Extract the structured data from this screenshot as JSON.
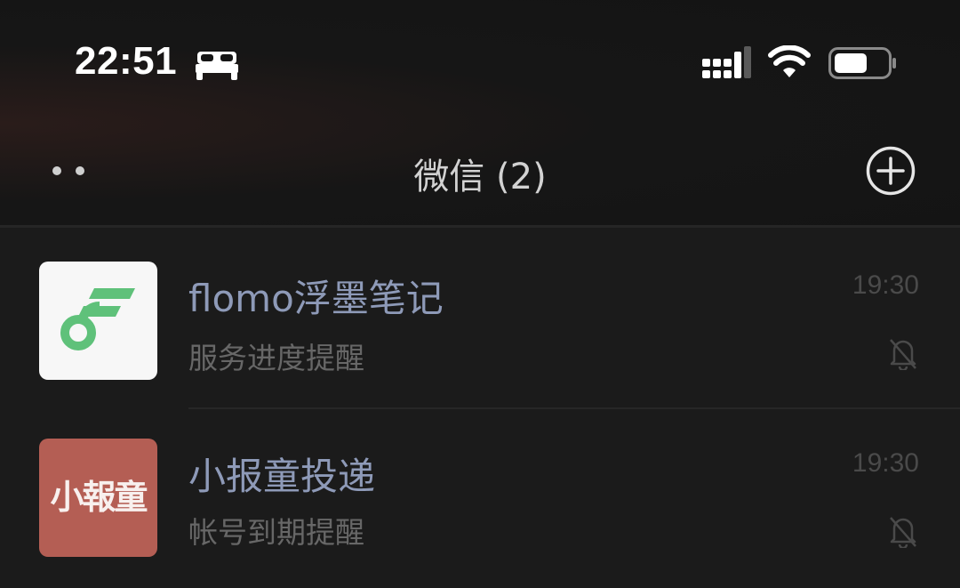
{
  "status_bar": {
    "time": "22:51",
    "sleep_icon": "bed-icon",
    "signal_icon": "cellular-signal-icon",
    "wifi_icon": "wifi-icon",
    "battery_icon": "battery-icon"
  },
  "nav": {
    "title": "微信 (2)",
    "more_icon": "more-dots-icon",
    "add_icon": "plus-circle-icon"
  },
  "chats": [
    {
      "name": "flomo浮墨笔记",
      "preview": "服务进度提醒",
      "time": "19:30",
      "muted": true,
      "avatar": "flomo-logo"
    },
    {
      "name": "小报童投递",
      "preview": "帐号到期提醒",
      "time": "19:30",
      "muted": true,
      "avatar_text": "小報童"
    }
  ],
  "colors": {
    "background": "#1b1b1b",
    "name_text": "#8e9ab8",
    "flomo_green": "#5fc17a",
    "xbt_red": "#b45e54"
  }
}
